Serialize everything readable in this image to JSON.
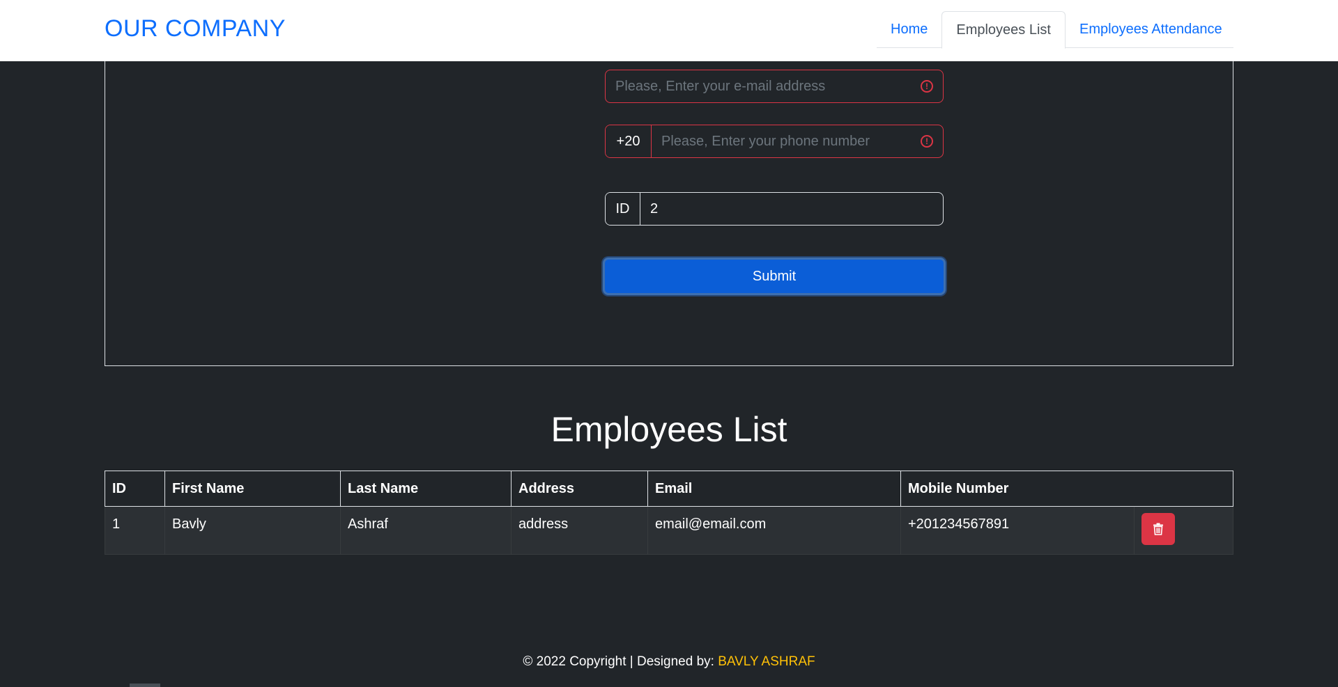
{
  "navbar": {
    "brand": "OUR COMPANY",
    "tabs": [
      {
        "label": "Home",
        "active": false
      },
      {
        "label": "Employees List",
        "active": true
      },
      {
        "label": "Employees Attendance",
        "active": false
      }
    ]
  },
  "form": {
    "email_placeholder": "Please, Enter your e-mail address",
    "phone_prefix": "+20",
    "phone_placeholder": "Please, Enter your phone number",
    "id_label": "ID",
    "id_value": "2",
    "submit_label": "Submit",
    "error_icon": "exclamation-circle-icon"
  },
  "list": {
    "title": "Employees List",
    "columns": [
      "ID",
      "First Name",
      "Last Name",
      "Address",
      "Email",
      "Mobile Number"
    ],
    "rows": [
      {
        "id": "1",
        "first_name": "Bavly",
        "last_name": "Ashraf",
        "address": "address",
        "email": "email@email.com",
        "mobile": "+201234567891"
      }
    ],
    "delete_icon": "trash-icon"
  },
  "footer": {
    "text": "© 2022 Copyright | Designed by: ",
    "designer": "BAVLY ASHRAF"
  },
  "colors": {
    "background": "#212529",
    "primary": "#0d6efd",
    "danger": "#dc3545",
    "warning": "#ffc107"
  }
}
